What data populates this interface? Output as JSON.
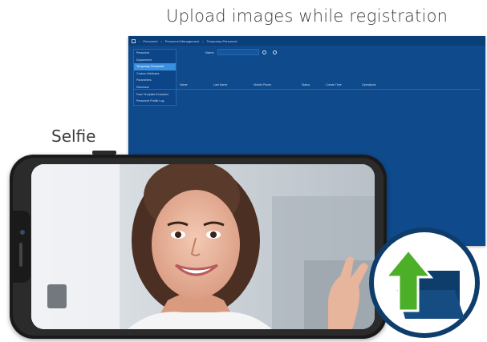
{
  "captions": {
    "top": "Upload images while registration",
    "selfie": "Selfie"
  },
  "app": {
    "breadcrumb": [
      "Personnel",
      "Personnel Management",
      "Temporary Personnel"
    ],
    "menu": [
      {
        "label": "Personnel",
        "active": false
      },
      {
        "label": "Department",
        "active": false
      },
      {
        "label": "Temporary Personnel",
        "active": true
      },
      {
        "label": "Custom Attributes",
        "active": false
      },
      {
        "label": "Parameters",
        "active": false
      },
      {
        "label": "Dismissal",
        "active": false
      },
      {
        "label": "Face Template Extracted",
        "active": false
      },
      {
        "label": "Personnel Profile Log",
        "active": false
      }
    ],
    "search_label": "Name",
    "columns": [
      "Name",
      "Last Name",
      "Mobile Phone",
      "Status",
      "Create Time",
      "Operations"
    ]
  },
  "colors": {
    "app_bg": "#0e4a8c",
    "menu_active": "#3a8fe0",
    "badge_green": "#4caf28",
    "badge_navy": "#0e3d6b"
  },
  "icons": [
    "home-icon",
    "search-icon",
    "refresh-icon",
    "upload-arrow-icon",
    "folder-icon"
  ]
}
